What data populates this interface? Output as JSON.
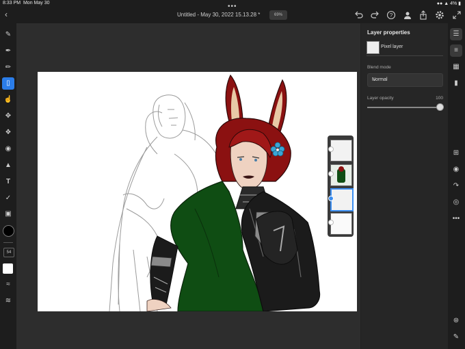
{
  "status_bar": {
    "time": "8:33 PM",
    "date": "Mon May 30",
    "battery": "4%"
  },
  "topbar": {
    "title": "Untitled - May 30, 2022 15.13.28 *",
    "zoom": "69%",
    "icons": [
      "back-icon",
      "more-dots-icon",
      "undo-icon",
      "redo-icon",
      "help-icon",
      "user-icon",
      "share-icon",
      "settings-icon",
      "fullscreen-icon"
    ]
  },
  "left_tools": [
    "brush-icon",
    "pixel-brush-icon",
    "mixer-icon",
    "eraser-icon",
    "smudge-icon",
    "transform-icon",
    "lasso-icon",
    "fill-icon",
    "shape-icon",
    "text-icon",
    "eyedropper-icon",
    "image-icon"
  ],
  "brush_size": "54",
  "colors": {
    "primary": "#000000",
    "secondary": "#ffffff",
    "accent": "#2b7de9"
  },
  "panel": {
    "title": "Layer properties",
    "layer_type": "Pixel layer",
    "blend_label": "Blend mode",
    "blend_value": "Normal",
    "opacity_label": "Layer opacity",
    "opacity_value": "100"
  },
  "right_icons": [
    "layers-icon",
    "properties-icon",
    "grid-icon",
    "comment-icon",
    "add-layer-icon",
    "visibility-icon",
    "import-icon",
    "mask-icon",
    "more-icon",
    "adjust-icon",
    "pen-icon"
  ],
  "layers_stack": [
    "sketch-layer",
    "color-layer",
    "selected-layer",
    "empty-layer"
  ]
}
